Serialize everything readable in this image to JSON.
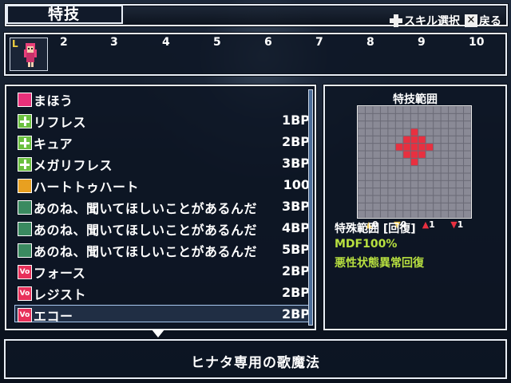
{
  "header": {
    "title": "特技",
    "hints": [
      {
        "icon": "dpad-icon",
        "label": "スキル選択"
      },
      {
        "icon": "x-button-icon",
        "label": "戻る"
      }
    ]
  },
  "level_bar": {
    "badge": "L",
    "levels": [
      "2",
      "3",
      "4",
      "5",
      "6",
      "7",
      "8",
      "9",
      "10"
    ]
  },
  "skills": [
    {
      "icon": "magic-category-icon",
      "name": "まほう",
      "cost": ""
    },
    {
      "icon": "heal-icon",
      "name": "リフレス",
      "cost": "1BP"
    },
    {
      "icon": "heal-icon",
      "name": "キュア",
      "cost": "2BP"
    },
    {
      "icon": "heal-icon",
      "name": "メガリフレス",
      "cost": "3BP"
    },
    {
      "icon": "heart-icon",
      "name": "ハートトゥハート",
      "cost": "100"
    },
    {
      "icon": "song-icon",
      "name": "あのね、聞いてほしいことがあるんだ",
      "cost": "3BP"
    },
    {
      "icon": "song-icon",
      "name": "あのね、聞いてほしいことがあるんだ",
      "cost": "4BP"
    },
    {
      "icon": "song-icon",
      "name": "あのね、聞いてほしいことがあるんだ",
      "cost": "5BP"
    },
    {
      "icon": "vo-icon",
      "name": "フォース",
      "cost": "2BP"
    },
    {
      "icon": "vo-icon",
      "name": "レジスト",
      "cost": "2BP"
    },
    {
      "icon": "vo-icon",
      "name": "エコー",
      "cost": "2BP"
    }
  ],
  "selected_index": 6,
  "range_panel": {
    "title": "特技範囲",
    "legend": [
      "0",
      "0",
      "1",
      "1"
    ],
    "range_label": "特殊範囲 [回復]",
    "mdf_label": "MDF100%",
    "effect_label": "悪性状態異常回復"
  },
  "description": "ヒナタ専用の歌魔法",
  "colors": {
    "accent_green": "#b8e040",
    "range_red": "#e83040",
    "window_border": "#e8eef6"
  }
}
